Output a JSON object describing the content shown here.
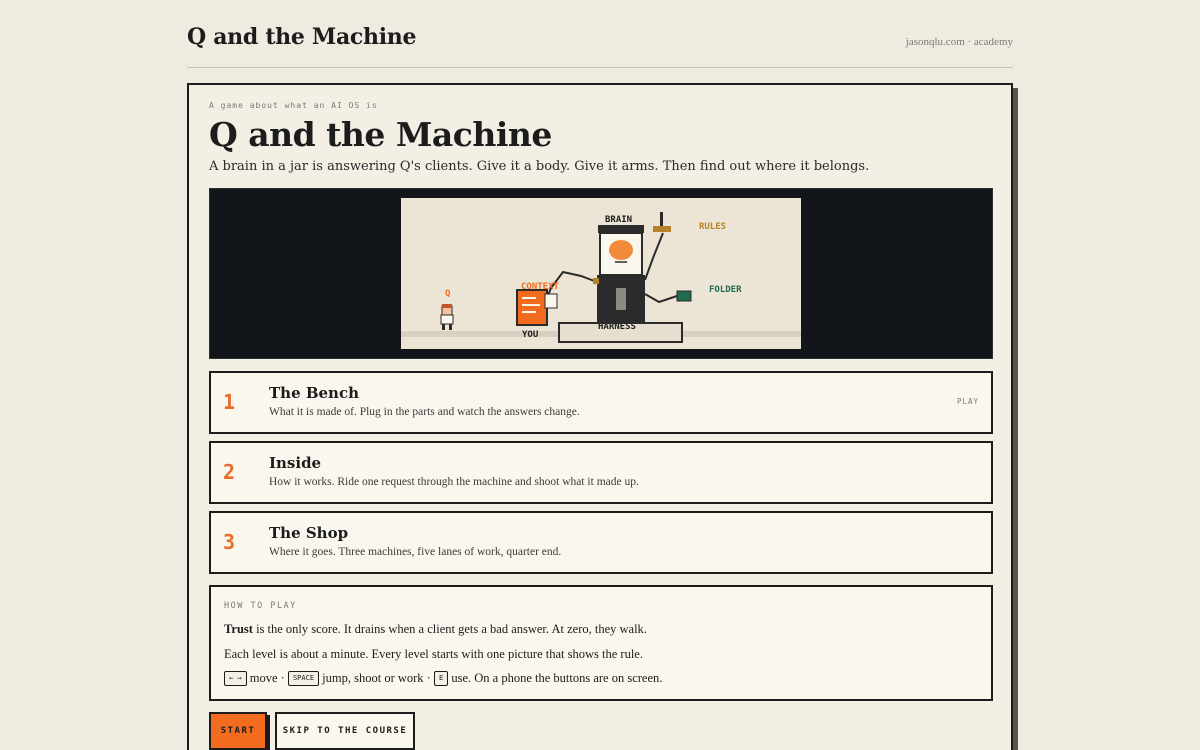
{
  "header": {
    "site_title": "Q and the Machine",
    "site_link": "jasonqlu.com · academy"
  },
  "intro": {
    "eyebrow": "A game about what an AI OS is",
    "title": "Q and the Machine",
    "subtitle": "A brain in a jar is answering Q's clients. Give it a body. Give it arms. Then find out where it belongs."
  },
  "scene": {
    "labels": {
      "brain": "BRAIN",
      "rules": "RULES",
      "folder": "FOLDER",
      "context": "CONTEXT",
      "q": "Q",
      "you": "YOU",
      "harness": "HARNESS"
    },
    "colors": {
      "orange": "#f26b1f",
      "dark": "#2b2b2b",
      "green": "#1f6b4f",
      "gold": "#b5822a",
      "floor": "#d8d1c1"
    }
  },
  "levels": [
    {
      "number": "1",
      "title": "The Bench",
      "desc": "What it is made of. Plug in the parts and watch the answers change.",
      "tag": "PLAY"
    },
    {
      "number": "2",
      "title": "Inside",
      "desc": "How it works. Ride one request through the machine and shoot what it made up."
    },
    {
      "number": "3",
      "title": "The Shop",
      "desc": "Where it goes. Three machines, five lanes of work, quarter end."
    }
  ],
  "howto": {
    "title": "HOW TO PLAY",
    "line1_bold": "Trust",
    "line1_rest": " is the only score. It drains when a client gets a bad answer. At zero, they walk.",
    "line2": "Each level is about a minute. Every level starts with one picture that shows the rule.",
    "key_move": "← →",
    "move_text": " move · ",
    "key_space": "SPACE",
    "space_text": " jump, shoot or work · ",
    "key_e": "E",
    "e_text": " use. On a phone the buttons are on screen."
  },
  "buttons": {
    "start": "START",
    "skip": "SKIP TO THE COURSE"
  }
}
